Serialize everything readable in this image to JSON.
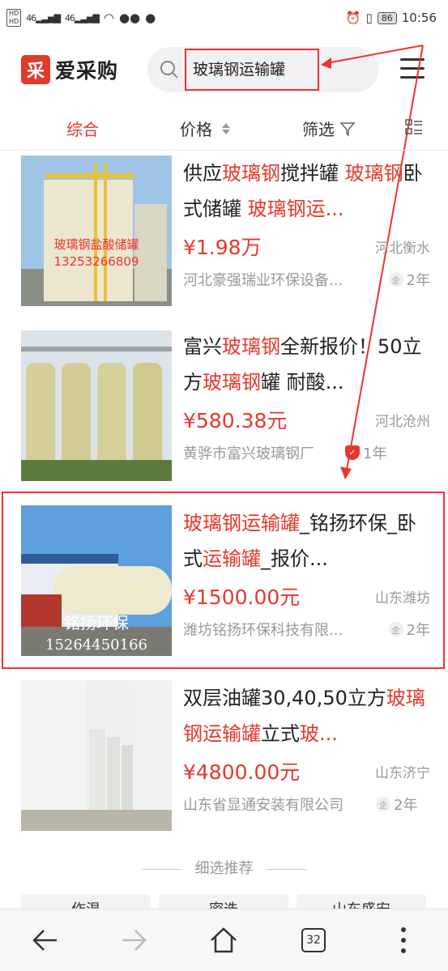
{
  "status_bar": {
    "hd1": "HD",
    "hd2": "HD",
    "signal1": "46",
    "signal2": "46",
    "battery": "86",
    "time": "10:56"
  },
  "header": {
    "logo_mark": "采",
    "logo_text": "爱采购",
    "search_value": "玻璃钢运输罐"
  },
  "tabs": {
    "comprehensive": "综合",
    "price": "价格",
    "filter": "筛选"
  },
  "products": [
    {
      "title_parts": [
        "供应",
        "玻璃钢",
        "搅拌罐 ",
        "玻璃",
        "钢",
        "卧式储罐 ",
        "玻璃钢运..."
      ],
      "price": "¥1.98万",
      "location": "河北衡水",
      "shop": "河北豪强瑞业环保设备...",
      "years": "2年",
      "image_caption1": "玻璃钢盐酸储罐",
      "image_caption2": "13253266809"
    },
    {
      "title_parts": [
        "富兴",
        "玻璃钢",
        "全新报价！50立方",
        "玻璃钢",
        "罐 耐酸..."
      ],
      "price": "¥580.38元",
      "location": "河北沧州",
      "shop": "黄骅市富兴玻璃钢厂",
      "years": "1年"
    },
    {
      "title_parts": [
        "玻璃钢运输罐",
        "_铭扬环保_卧式",
        "运输罐",
        "_报价..."
      ],
      "price": "¥1500.00元",
      "location": "山东潍坊",
      "shop": "潍坊铭扬环保科技有限...",
      "years": "2年",
      "image_caption1": "铭扬环保",
      "image_caption2": "15264450166"
    },
    {
      "title_parts": [
        "双层油罐30,40,50立方",
        "玻璃钢运输罐",
        "立式",
        "玻..."
      ],
      "price": "¥4800.00元",
      "location": "山东济宁",
      "shop": "山东省显通安装有限公司",
      "years": "2年"
    }
  ],
  "recommend": {
    "heading": "细选推荐",
    "chips": [
      "作温",
      "密迭",
      "山东盛安"
    ]
  },
  "bottom_nav": {
    "tab_count": "32"
  },
  "colors": {
    "accent": "#e5382c"
  }
}
